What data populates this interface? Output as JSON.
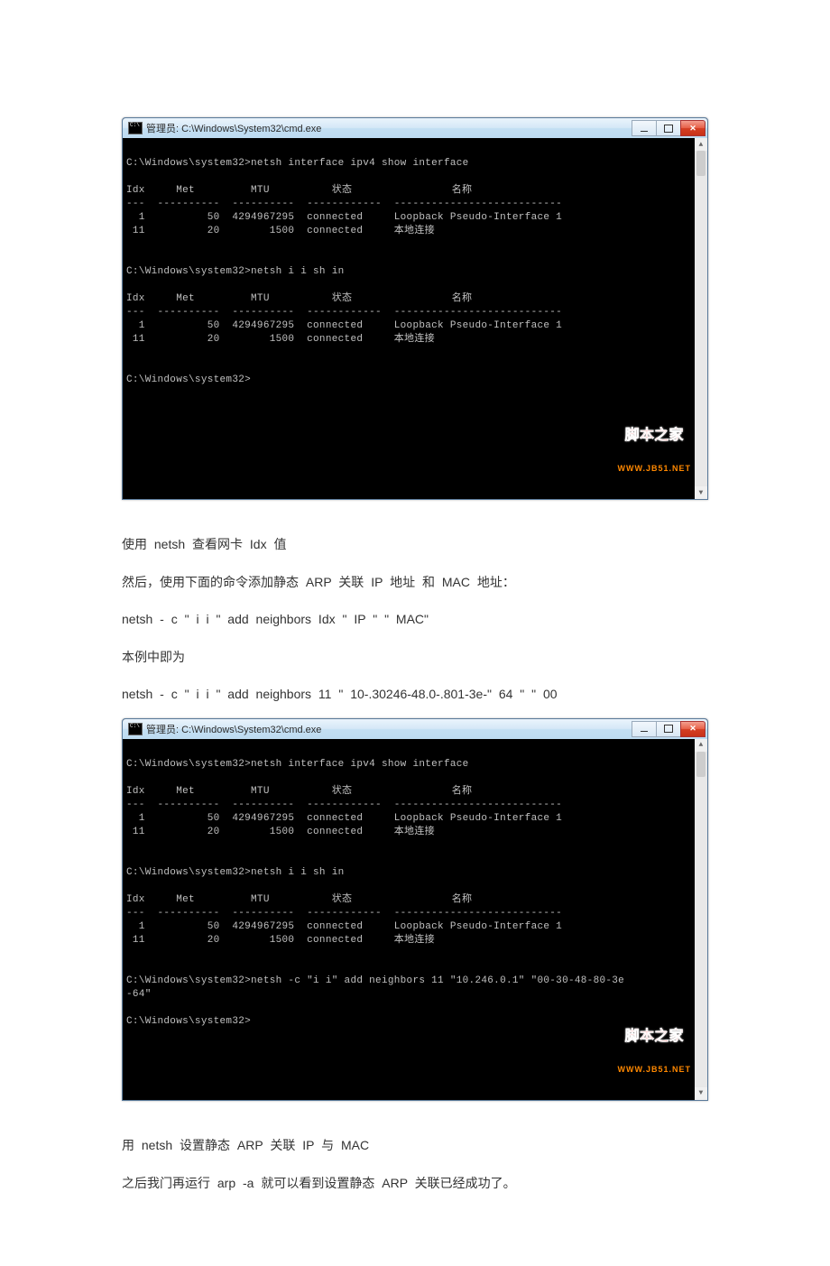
{
  "terminal1": {
    "title": "管理员: C:\\Windows\\System32\\cmd.exe",
    "lines": [
      "C:\\Windows\\system32>netsh interface ipv4 show interface",
      "",
      "Idx     Met         MTU          状态                名称",
      "---  ----------  ----------  ------------  ---------------------------",
      "  1          50  4294967295  connected     Loopback Pseudo-Interface 1",
      " 11          20        1500  connected     本地连接",
      "",
      "",
      "C:\\Windows\\system32>netsh i i sh in",
      "",
      "Idx     Met         MTU          状态                名称",
      "---  ----------  ----------  ------------  ---------------------------",
      "  1          50  4294967295  connected     Loopback Pseudo-Interface 1",
      " 11          20        1500  connected     本地连接",
      "",
      "",
      "C:\\Windows\\system32>",
      "",
      "",
      "",
      "",
      ""
    ],
    "watermark_top": "脚本之家",
    "watermark_bottom": "WWW.JB51.NET"
  },
  "article1": {
    "p1": "使用   netsh   查看网卡    Idx   值",
    "p2": "然后，使用下面的命令添加静态        ARP 关联  IP 地址  和  MAC 地址：",
    "p3": "netsh - c    \" i i    \"   add neighbors Idx               \" IP \"     \" MAC\"",
    "p4": "本例中即为",
    "p5": "netsh - c    \" i i    \"    add neighbors 11               \" 10-.30246-48.0-.801-3e-\" 64 \" \" 00"
  },
  "terminal2": {
    "title": "管理员: C:\\Windows\\System32\\cmd.exe",
    "lines": [
      "C:\\Windows\\system32>netsh interface ipv4 show interface",
      "",
      "Idx     Met         MTU          状态                名称",
      "---  ----------  ----------  ------------  ---------------------------",
      "  1          50  4294967295  connected     Loopback Pseudo-Interface 1",
      " 11          20        1500  connected     本地连接",
      "",
      "",
      "C:\\Windows\\system32>netsh i i sh in",
      "",
      "Idx     Met         MTU          状态                名称",
      "---  ----------  ----------  ------------  ---------------------------",
      "  1          50  4294967295  connected     Loopback Pseudo-Interface 1",
      " 11          20        1500  connected     本地连接",
      "",
      "",
      "C:\\Windows\\system32>netsh -c \"i i\" add neighbors 11 \"10.246.0.1\" \"00-30-48-80-3e",
      "-64\"",
      "",
      "C:\\Windows\\system32>",
      "",
      ""
    ],
    "watermark_top": "脚本之家",
    "watermark_bottom": "WWW.JB51.NET"
  },
  "article2": {
    "p1": "用 netsh  设置静态  ARP 关联 IP  与 MAC",
    "p2": "之后我门再运行    arp -a   就可以看到设置静态     ARP 关联已经成功了。"
  }
}
